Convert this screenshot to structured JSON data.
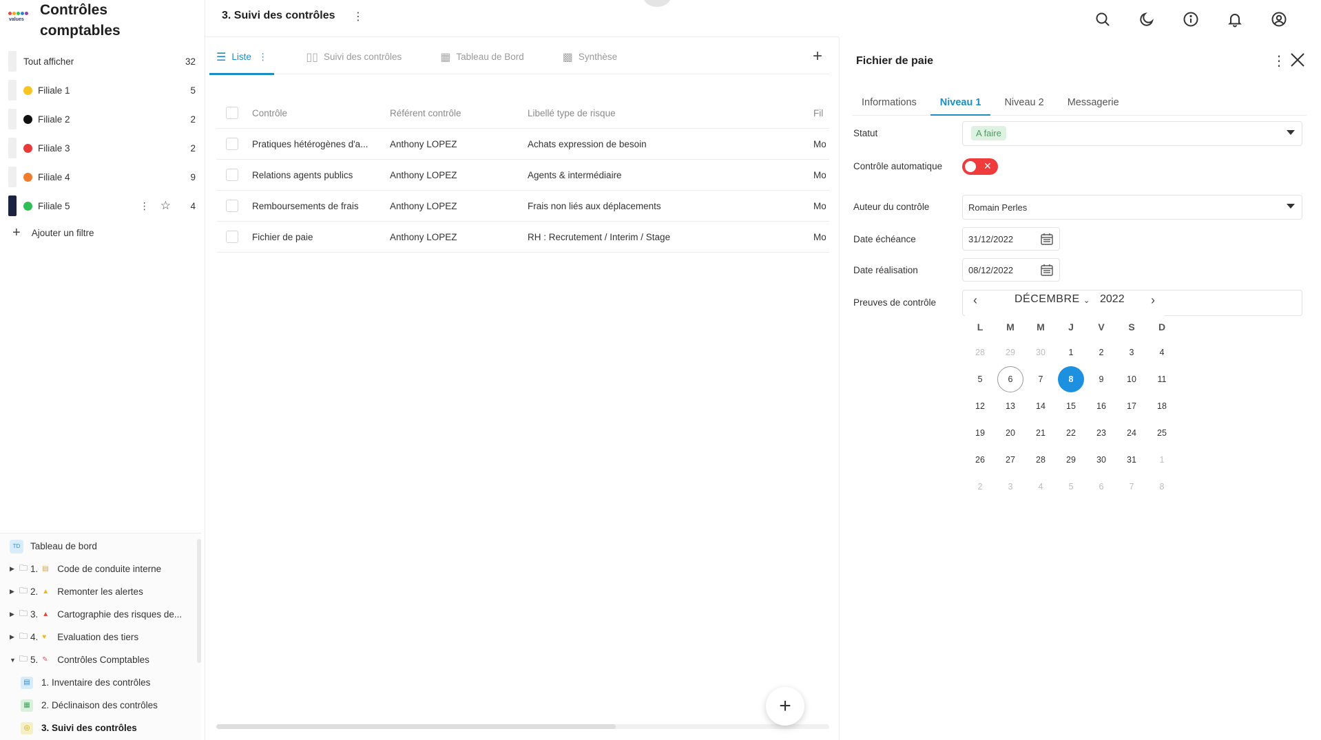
{
  "app": {
    "title": "Contrôles comptables",
    "logo_text": "values",
    "page_title": "3. Suivi des contrôles"
  },
  "filters": {
    "all": {
      "label": "Tout afficher",
      "count": "32"
    },
    "items": [
      {
        "label": "Filiale 1",
        "count": "5",
        "color": "#f7c520"
      },
      {
        "label": "Filiale 2",
        "count": "2",
        "color": "#111111"
      },
      {
        "label": "Filiale 3",
        "count": "2",
        "color": "#e93a3a"
      },
      {
        "label": "Filiale 4",
        "count": "9",
        "color": "#f27b2c"
      },
      {
        "label": "Filiale 5",
        "count": "4",
        "color": "#2fbf55"
      }
    ],
    "add_label": "Ajouter un filtre"
  },
  "tree": {
    "dashboard": {
      "badge": "TD",
      "label": "Tableau de bord"
    },
    "items": [
      {
        "num": "1.",
        "label": "Code de conduite interne"
      },
      {
        "num": "2.",
        "label": "Remonter les alertes"
      },
      {
        "num": "3.",
        "label": "Cartographie des risques de..."
      },
      {
        "num": "4.",
        "label": "Evaluation des tiers"
      },
      {
        "num": "5.",
        "label": "Contrôles Comptables"
      }
    ],
    "subitems": [
      {
        "label": "1. Inventaire des contrôles"
      },
      {
        "label": "2. Déclinaison des contrôles"
      },
      {
        "label": "3. Suivi des contrôles"
      }
    ]
  },
  "views": {
    "tabs": [
      {
        "label": "Liste"
      },
      {
        "label": "Suivi des contrôles"
      },
      {
        "label": "Tableau de Bord"
      },
      {
        "label": "Synthèse"
      }
    ]
  },
  "table": {
    "headers": [
      "Contrôle",
      "Référent contrôle",
      "Libellé type de risque",
      "Fil"
    ],
    "rows": [
      [
        "Pratiques hétérogènes d'a...",
        "Anthony LOPEZ",
        "Achats expression de besoin",
        "Mo"
      ],
      [
        "Relations agents publics",
        "Anthony LOPEZ",
        "Agents & intermédiaire",
        "Mo"
      ],
      [
        "Remboursements de frais",
        "Anthony LOPEZ",
        "Frais non liés aux déplacements",
        "Mo"
      ],
      [
        "Fichier de paie",
        "Anthony LOPEZ",
        "RH : Recrutement / Interim / Stage",
        "Mo"
      ]
    ]
  },
  "panel": {
    "title": "Fichier de paie",
    "tabs": [
      "Informations",
      "Niveau 1",
      "Niveau 2",
      "Messagerie"
    ],
    "fields": {
      "statut_label": "Statut",
      "statut_value": "A faire",
      "auto_label": "Contrôle automatique",
      "auteur_label": "Auteur du contrôle",
      "auteur_value": "Romain Perles",
      "echeance_label": "Date échéance",
      "echeance_value": "31/12/2022",
      "realisation_label": "Date réalisation",
      "realisation_value": "08/12/2022",
      "preuves_label": "Preuves de contrôle"
    }
  },
  "calendar": {
    "month": "DÉCEMBRE",
    "year": "2022",
    "weekdays": [
      "L",
      "M",
      "M",
      "J",
      "V",
      "S",
      "D"
    ],
    "days": [
      "28",
      "29",
      "30",
      "1",
      "2",
      "3",
      "4",
      "5",
      "6",
      "7",
      "8",
      "9",
      "10",
      "11",
      "12",
      "13",
      "14",
      "15",
      "16",
      "17",
      "18",
      "19",
      "20",
      "21",
      "22",
      "23",
      "24",
      "25",
      "26",
      "27",
      "28",
      "29",
      "30",
      "31",
      "1",
      "2",
      "3",
      "4",
      "5",
      "6",
      "7",
      "8"
    ],
    "muted_indices": [
      0,
      1,
      2,
      34,
      35,
      36,
      37,
      38,
      39,
      40,
      41
    ],
    "today_index": 8,
    "selected_index": 10
  },
  "colors": {
    "accent": "#1a8fbf",
    "selected_day": "#1e90e0",
    "toggle_off": "#ef3b3b",
    "chip_bg": "#def2e2",
    "chip_text": "#4e9a62"
  }
}
